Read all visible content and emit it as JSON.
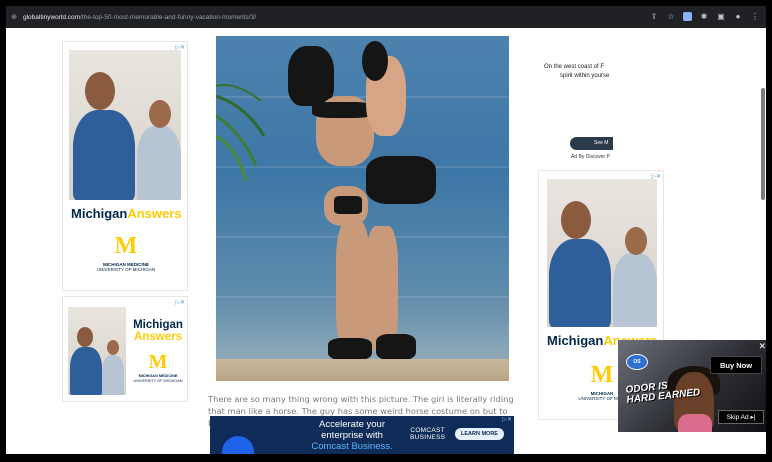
{
  "browser": {
    "url_domain": "globaltinyworld.com",
    "url_path": "/the-top-50-most-memorable-and-funny-vacation-moments/3/",
    "toolbar_icons": [
      "share-icon",
      "star-icon",
      "extension-icon",
      "puzzle-icon",
      "sidebar-icon",
      "profile-icon",
      "menu-icon"
    ]
  },
  "left_ads": [
    {
      "brand_primary": "Michigan",
      "brand_secondary": "Answers",
      "logo_letter": "M",
      "sub_line1": "MICHIGAN MEDICINE",
      "sub_line2": "UNIVERSITY OF MICHIGAN"
    },
    {
      "brand_primary": "Michigan",
      "brand_secondary": "Answers",
      "logo_letter": "M",
      "sub_line1": "MICHIGAN MEDICINE",
      "sub_line2": "UNIVERSITY OF MICHIGAN"
    }
  ],
  "article": {
    "caption": "There are so many thing wrong with this picture. The girl is literally riding that man like a horse. The guy has some weird horse costume on but to be honest"
  },
  "bottom_ad": {
    "headline_1": "Accelerate your",
    "headline_2": "enterprise with",
    "headline_accent": "Comcast Business.",
    "brand_1": "COMCAST",
    "brand_2": "BUSINESS",
    "cta": "LEARN MORE"
  },
  "right_text_ad": {
    "line_1": "On the west coast of F",
    "line_2": "spirit within yourse",
    "button": "See M",
    "by_line": "Ad By Discover P"
  },
  "right_ad": {
    "brand_primary": "Michigan",
    "brand_secondary": "Answers",
    "logo_letter": "M",
    "sub_line1": "MICHIGAN",
    "sub_line2": "UNIVERSITY OF MICH"
  },
  "video_ad": {
    "tagline_1": "ODOR IS",
    "tagline_2": "HARD EARNED",
    "buy": "Buy Now",
    "skip": "Skip Ad ▸|",
    "close": "✕",
    "logo": "OS"
  },
  "colors": {
    "chrome_bg": "#202124",
    "michigan_blue": "#00274c",
    "maize": "#ffcb05",
    "comcast_navy": "#0f2b57"
  }
}
